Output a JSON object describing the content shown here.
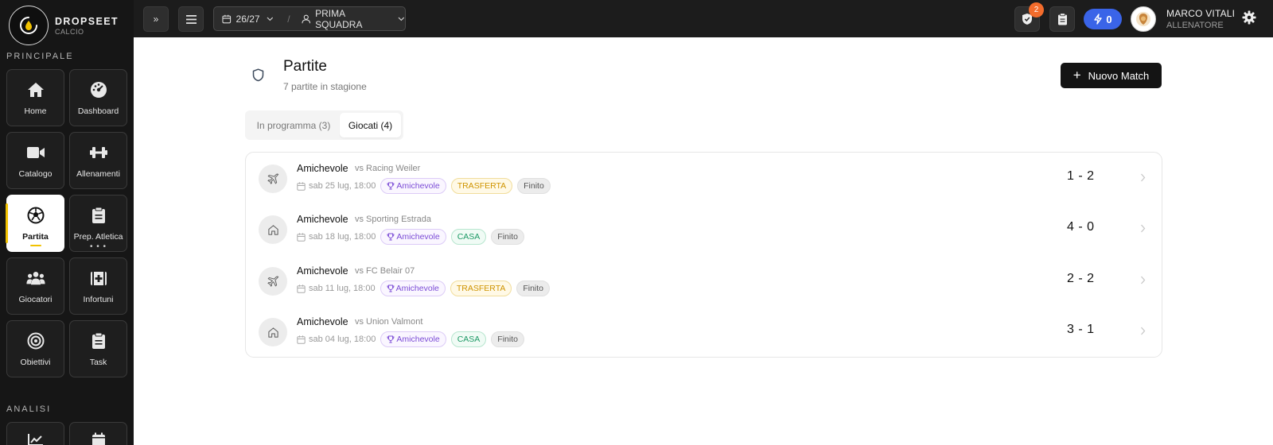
{
  "brand": {
    "name": "DROPSEET",
    "sub": "CALCIO"
  },
  "sidebar": {
    "section_main": "PRINCIPALE",
    "section_analysis": "ANALISI",
    "items": [
      {
        "label": "Home",
        "icon": "home-icon"
      },
      {
        "label": "Dashboard",
        "icon": "dashboard-icon"
      },
      {
        "label": "Catalogo",
        "icon": "video-icon"
      },
      {
        "label": "Allenamenti",
        "icon": "dumbbell-icon"
      },
      {
        "label": "Partita",
        "icon": "soccer-ball-icon",
        "active": true
      },
      {
        "label": "Prep. Atletica",
        "icon": "clipboard-icon"
      },
      {
        "label": "Giocatori",
        "icon": "users-icon"
      },
      {
        "label": "Infortuni",
        "icon": "medical-kit-icon"
      },
      {
        "label": "Obiettivi",
        "icon": "target-icon"
      },
      {
        "label": "Task",
        "icon": "task-clipboard-icon"
      }
    ],
    "analysis_items": [
      {
        "icon": "chart-line-icon"
      },
      {
        "icon": "calendar-check-icon"
      }
    ]
  },
  "topbar": {
    "expand_label": "»",
    "season": "26/27",
    "separator": "/",
    "team": "PRIMA SQUADRA",
    "notifications_count": "2",
    "energy": "0",
    "user_name": "MARCO VITALI",
    "user_role": "ALLENATORE"
  },
  "page": {
    "title": "Partite",
    "subtitle": "7 partite in stagione",
    "new_button": "Nuovo Match",
    "tabs": [
      "In programma (3)",
      "Giocati (4)"
    ],
    "active_tab": 1
  },
  "matches": [
    {
      "competition": "Amichevole",
      "opponent": "vs Racing Weiler",
      "date": "sab 25 lug, 18:00",
      "type_tag": "Amichevole",
      "venue": "TRASFERTA",
      "status": "Finito",
      "score": "1 - 2",
      "icon": "plane-icon"
    },
    {
      "competition": "Amichevole",
      "opponent": "vs Sporting Estrada",
      "date": "sab 18 lug, 18:00",
      "type_tag": "Amichevole",
      "venue": "CASA",
      "status": "Finito",
      "score": "4 - 0",
      "icon": "house-icon"
    },
    {
      "competition": "Amichevole",
      "opponent": "vs FC Belair 07",
      "date": "sab 11 lug, 18:00",
      "type_tag": "Amichevole",
      "venue": "TRASFERTA",
      "status": "Finito",
      "score": "2 - 2",
      "icon": "plane-icon"
    },
    {
      "competition": "Amichevole",
      "opponent": "vs Union Valmont",
      "date": "sab 04 lug, 18:00",
      "type_tag": "Amichevole",
      "venue": "CASA",
      "status": "Finito",
      "score": "3 - 1",
      "icon": "house-icon"
    }
  ],
  "colors": {
    "sidebar_bg": "#161616",
    "topbar_bg": "#1c1c1c",
    "active_indicator": "#f2c200",
    "energy_blue": "#3a64e8",
    "notification_orange": "#f36c2c",
    "tag_competition": "#7b4bd6",
    "tag_away": "#cf9400",
    "tag_home": "#1e9a66"
  }
}
